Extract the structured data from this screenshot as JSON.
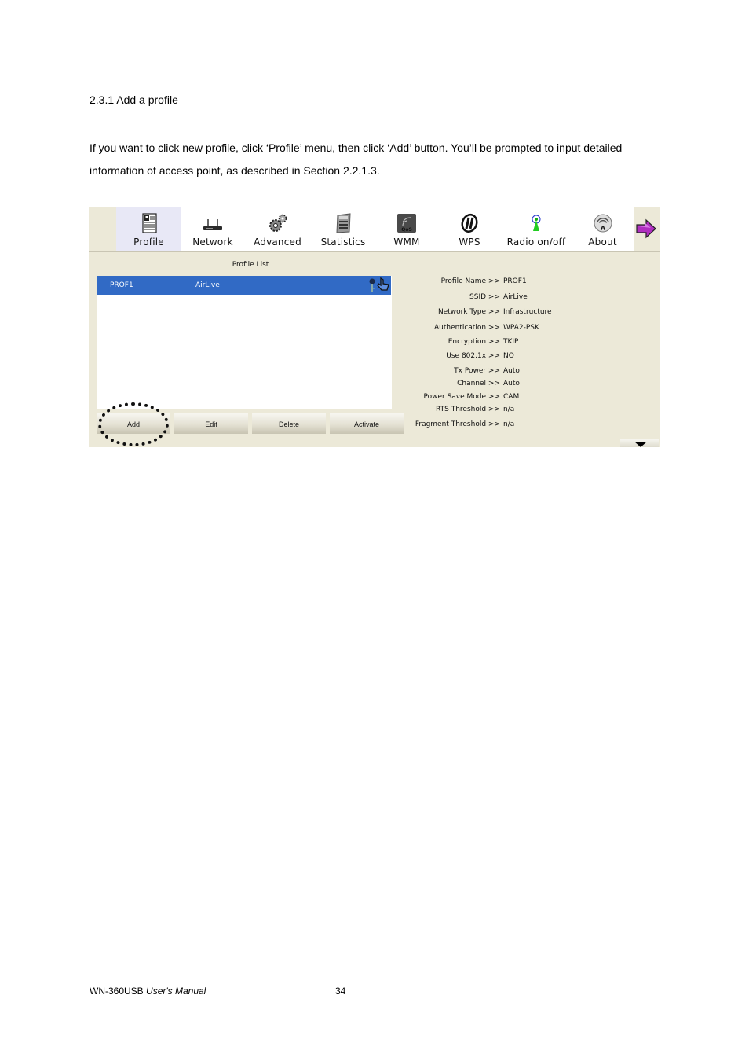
{
  "document": {
    "heading": "2.3.1 Add a profile",
    "paragraph": "If you want to click new profile, click ‘Profile’ menu, then click ‘Add’ button. You’ll be prompted to input detailed information of access point, as described in Section 2.2.1.3.",
    "footer": {
      "product": "WN-360USB",
      "manual": "User's Manual",
      "page": "34"
    }
  },
  "app": {
    "toolbar": [
      {
        "label": "Profile",
        "icon": "profile-icon",
        "active": true
      },
      {
        "label": "Network",
        "icon": "router-icon"
      },
      {
        "label": "Advanced",
        "icon": "gears-icon"
      },
      {
        "label": "Statistics",
        "icon": "calculator-icon"
      },
      {
        "label": "WMM",
        "icon": "qos-icon"
      },
      {
        "label": "WPS",
        "icon": "wps-icon"
      },
      {
        "label": "Radio on/off",
        "icon": "antenna-icon"
      },
      {
        "label": "About",
        "icon": "about-icon"
      }
    ],
    "next_icon": "arrow-right-icon",
    "profile_list": {
      "title": "Profile List",
      "rows": [
        {
          "profile": "PROF1",
          "ssid": "AirLive",
          "selected": true,
          "icons": [
            "key-icon",
            "hand-icon"
          ]
        }
      ]
    },
    "buttons": {
      "add": "Add",
      "edit": "Edit",
      "delete": "Delete",
      "activate": "Activate"
    },
    "details": [
      {
        "key": "Profile Name >>",
        "value": "PROF1"
      },
      {
        "key": "SSID >>",
        "value": "AirLive"
      },
      {
        "key": "Network Type >>",
        "value": "Infrastructure"
      },
      {
        "key": "Authentication >>",
        "value": "WPA2-PSK"
      },
      {
        "key": "Encryption >>",
        "value": "TKIP"
      },
      {
        "key": "Use 802.1x >>",
        "value": "NO"
      },
      {
        "key": "Tx Power >>",
        "value": "Auto"
      },
      {
        "key": "Channel >>",
        "value": "Auto"
      },
      {
        "key": "Power Save Mode >>",
        "value": "CAM"
      },
      {
        "key": "RTS Threshold >>",
        "value": "n/a"
      },
      {
        "key": "Fragment Threshold >>",
        "value": "n/a"
      }
    ],
    "selection_color": "#316ac5",
    "background_color": "#ece9d8"
  }
}
